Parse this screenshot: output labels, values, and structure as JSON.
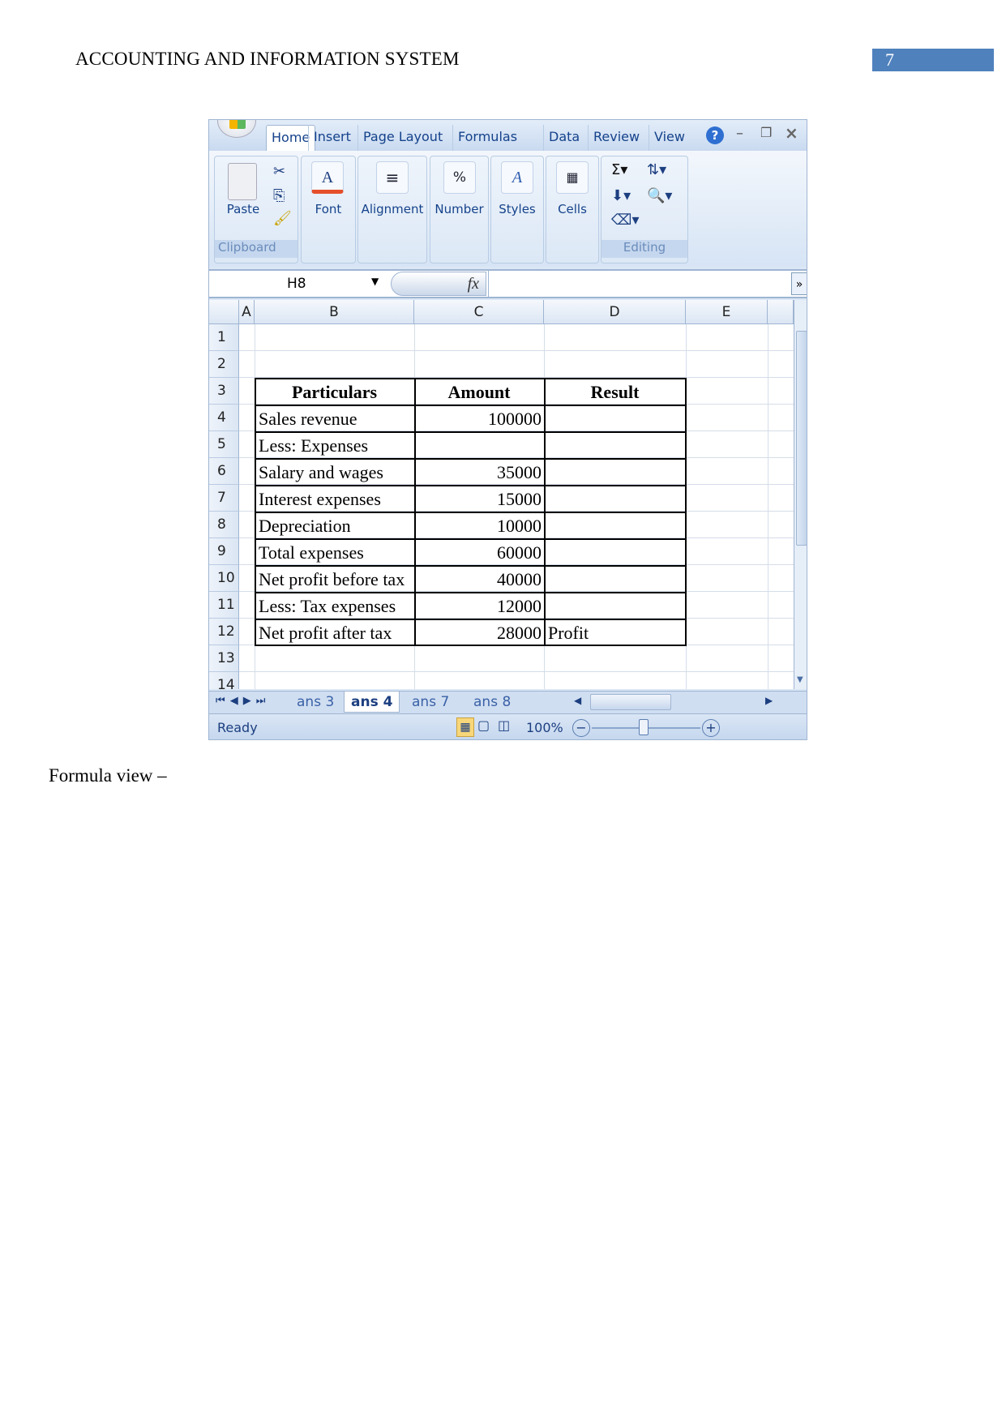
{
  "page": {
    "header": "ACCOUNTING AND INFORMATION SYSTEM",
    "page_number": "7",
    "caption": "Formula view –",
    "accent": "#4f81bd"
  },
  "excel": {
    "ribbon_tabs": [
      "Home",
      "Insert",
      "Page Layout",
      "Formulas",
      "Data",
      "Review",
      "View"
    ],
    "active_tab": "Home",
    "groups": {
      "paste": "Paste",
      "clipboard": "Clipboard",
      "font": "Font",
      "alignment": "Alignment",
      "number": "Number",
      "styles": "Styles",
      "cells": "Cells",
      "editing": "Editing"
    },
    "name_box": "H8",
    "fx": "fx",
    "columns": [
      "A",
      "B",
      "C",
      "D",
      "E"
    ],
    "rows": [
      "1",
      "2",
      "3",
      "4",
      "5",
      "6",
      "7",
      "8",
      "9",
      "10",
      "11",
      "12",
      "13",
      "14"
    ],
    "table": {
      "headers": [
        "Particulars",
        "Amount",
        "Result"
      ],
      "rows": [
        [
          "Sales revenue",
          "100000",
          ""
        ],
        [
          "Less: Expenses",
          "",
          ""
        ],
        [
          "Salary and wages",
          "35000",
          ""
        ],
        [
          "Interest expenses",
          "15000",
          ""
        ],
        [
          "Depreciation",
          "10000",
          ""
        ],
        [
          "Total expenses",
          "60000",
          ""
        ],
        [
          "Net profit before tax",
          "40000",
          ""
        ],
        [
          "Less: Tax expenses",
          "12000",
          ""
        ],
        [
          "Net profit after tax",
          "28000",
          "Profit"
        ]
      ]
    },
    "sheet_tabs": [
      "ans 3",
      "ans 4",
      "ans 7",
      "ans 8"
    ],
    "active_sheet": "ans 4",
    "status": "Ready",
    "zoom": "100%"
  }
}
